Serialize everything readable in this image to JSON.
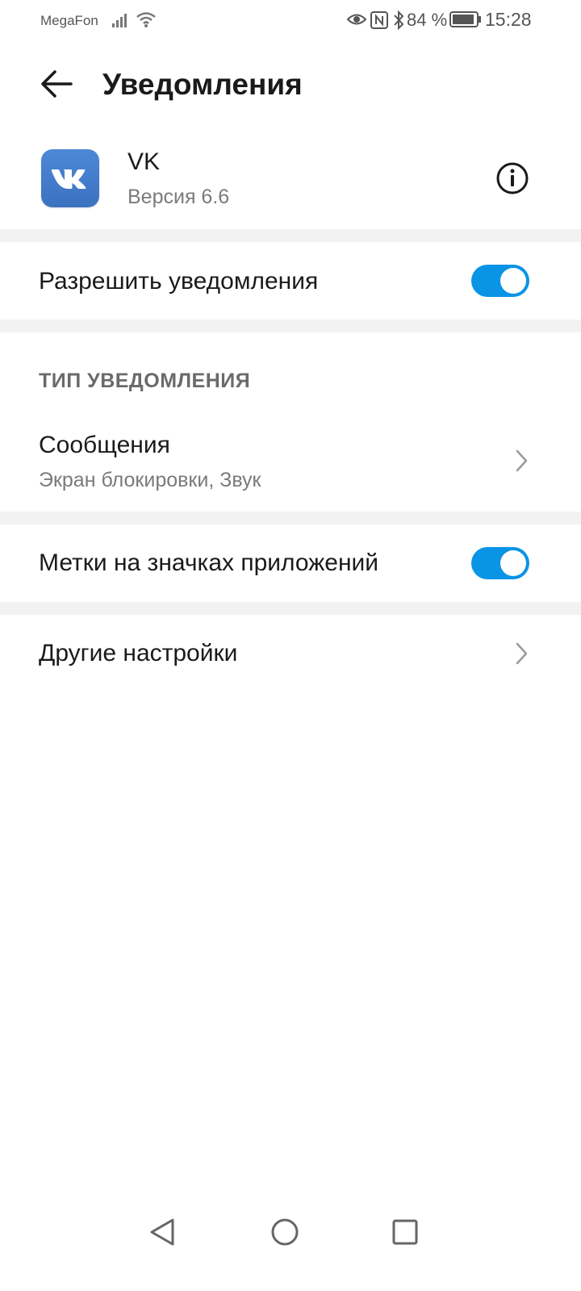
{
  "status_bar": {
    "carrier": "MegaFon",
    "battery": "84 %",
    "time": "15:28",
    "icons": [
      "signal-icon",
      "wifi-icon",
      "eye-icon",
      "nfc-icon",
      "bluetooth-icon",
      "battery-icon"
    ]
  },
  "header": {
    "title": "Уведомления",
    "back_icon": "arrow-left-icon"
  },
  "app": {
    "name": "VK",
    "version": "Версия 6.6",
    "icon": "vk-logo",
    "info_icon": "info-icon"
  },
  "settings": {
    "allow_notifications": {
      "label": "Разрешить уведомления",
      "enabled": true
    },
    "section_header": "ТИП УВЕДОМЛЕНИЯ",
    "messages": {
      "label": "Сообщения",
      "subtitle": "Экран блокировки, Звук"
    },
    "badges": {
      "label": "Метки на значках приложений",
      "enabled": true
    },
    "other": {
      "label": "Другие настройки"
    }
  },
  "nav_bar": {
    "icons": [
      "back-triangle-icon",
      "home-circle-icon",
      "recents-square-icon"
    ]
  },
  "colors": {
    "accent": "#0a94e6",
    "vk_brand": "#4680c2",
    "separator": "#f2f2f2"
  }
}
